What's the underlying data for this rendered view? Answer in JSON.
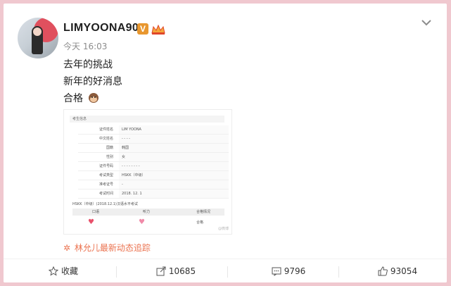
{
  "user": {
    "name": "LIMYOONA90",
    "verified_badge": "V"
  },
  "post": {
    "time": "今天 16:03",
    "lines": [
      "去年的挑战",
      "新年的好消息",
      "合格"
    ],
    "emoji": "monkey-face-icon"
  },
  "document": {
    "header": "考生信息",
    "rows": [
      {
        "label": "证件姓名",
        "value": "LIM YOONA"
      },
      {
        "label": "中文姓名",
        "value": "- - - -"
      },
      {
        "label": "国籍",
        "value": "韩国"
      },
      {
        "label": "性别",
        "value": "女"
      },
      {
        "label": "证件号码",
        "value": "- - - - - - - -"
      },
      {
        "label": "考试类型",
        "value": "HSKK（中级）"
      },
      {
        "label": "准考证号",
        "value": "-"
      },
      {
        "label": "考试时间",
        "value": "2018. 12. 1"
      }
    ],
    "result_title": "HSKK（中级）(2018.12.1)汉语水平考试",
    "result_headers": [
      "口语",
      "听力",
      "合格情况"
    ],
    "result_status": "合格",
    "watermark": "@微博"
  },
  "follow_link": "林允儿最新动态追踪",
  "actions": {
    "favorite": "收藏",
    "repost_count": "10685",
    "comment_count": "9796",
    "like_count": "93054"
  },
  "colors": {
    "background": "#f0c8cf",
    "link": "#eb7350",
    "badge": "#e8972f"
  }
}
